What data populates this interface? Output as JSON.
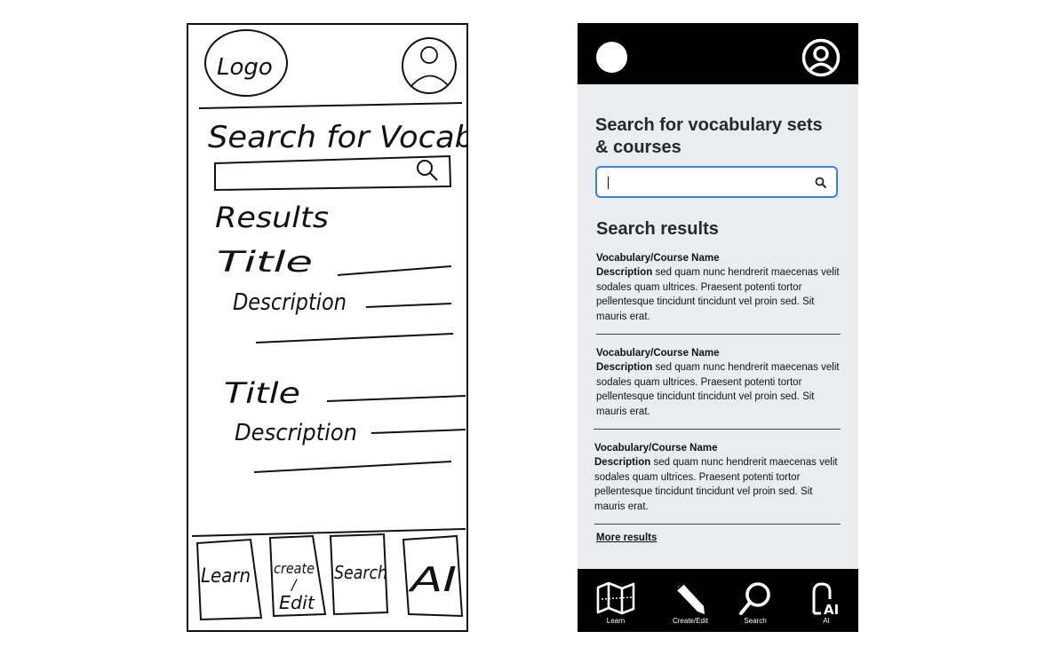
{
  "sketch": {
    "logo": "Logo",
    "search_heading": "Search for Vocab",
    "results": "Results",
    "title_1": "Title",
    "description_1": "Description",
    "title_2": "Title",
    "description_2": "Description",
    "nav": [
      "Learn",
      "create",
      "/",
      "Edit",
      "Search",
      "AI"
    ]
  },
  "mockup": {
    "search_heading": "Search for vocabulary sets & courses",
    "search_value": "",
    "results_heading": "Search results",
    "results": [
      {
        "name": "Vocabulary/Course Name",
        "desc_label": "Description",
        "desc": " sed quam nunc hendrerit maecenas velit sodales quam ultrices. Praesent potenti tortor pellentesque tincidunt tincidunt vel proin sed. Sit mauris erat."
      },
      {
        "name": "Vocabulary/Course Name",
        "desc_label": "Description",
        "desc": " sed quam nunc hendrerit maecenas velit sodales quam ultrices. Praesent potenti tortor pellentesque tincidunt tincidunt vel proin sed. Sit mauris erat."
      },
      {
        "name": "Vocabulary/Course Name",
        "desc_label": "Description",
        "desc": " sed quam nunc hendrerit maecenas velit sodales quam ultrices. Praesent potenti tortor pellentesque tincidunt tincidunt vel proin sed. Sit mauris erat."
      }
    ],
    "more_results": "More results",
    "nav": [
      {
        "label": "Learn",
        "icon": "map-icon"
      },
      {
        "label": "Create/Edit",
        "icon": "pencil-icon"
      },
      {
        "label": "Search",
        "icon": "search-icon"
      },
      {
        "label": "AI",
        "icon": "ai-icon"
      }
    ],
    "colors": {
      "bar": "#000000",
      "background": "#eaedf0",
      "accent": "#3d7fe6"
    }
  }
}
